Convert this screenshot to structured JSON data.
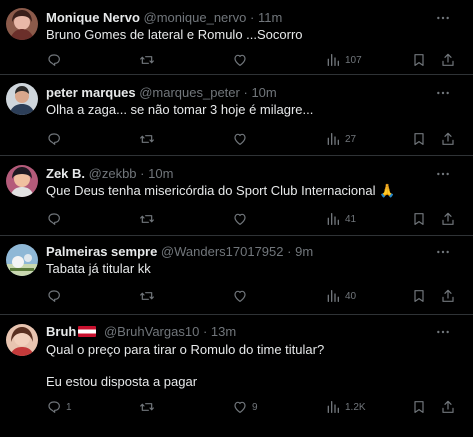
{
  "colors": {
    "background": "#000000",
    "text": "#e7e9ea",
    "muted": "#71767b",
    "divider": "#2f3336"
  },
  "tweets": [
    {
      "name": "Monique Nervo",
      "handle": "@monique_nervo",
      "dot": "·",
      "time": "11m",
      "text": "Bruno Gomes de lateral e Romulo ...Socorro",
      "counts": {
        "reply": "",
        "retweet": "",
        "like": "",
        "views": "107"
      }
    },
    {
      "name": "peter marques",
      "handle": "@marques_peter",
      "dot": "·",
      "time": "10m",
      "text": "Olha a zaga... se não tomar 3 hoje é milagre...",
      "counts": {
        "reply": "",
        "retweet": "",
        "like": "",
        "views": "27"
      }
    },
    {
      "name": "Zek B.",
      "handle": "@zekbb",
      "dot": "·",
      "time": "10m",
      "text": "Que Deus tenha misericórdia do Sport Club Internacional 🙏",
      "counts": {
        "reply": "",
        "retweet": "",
        "like": "",
        "views": "41"
      }
    },
    {
      "name": "Palmeiras sempre",
      "handle": "@Wanders17017952",
      "dot": "·",
      "time": "9m",
      "text": "Tabata já titular kk",
      "counts": {
        "reply": "",
        "retweet": "",
        "like": "",
        "views": "40"
      }
    },
    {
      "name": "Bruh",
      "handle": "@BruhVargas10",
      "dot": "·",
      "time": "13m",
      "text": "Qual o preço para tirar o Romulo do time titular?",
      "text2": "Eu estou disposta a pagar",
      "counts": {
        "reply": "1",
        "retweet": "",
        "like": "9",
        "views": "1.2K"
      }
    }
  ],
  "icons": [
    "more-icon",
    "reply-icon",
    "retweet-icon",
    "like-icon",
    "views-icon",
    "bookmark-icon",
    "share-icon"
  ]
}
